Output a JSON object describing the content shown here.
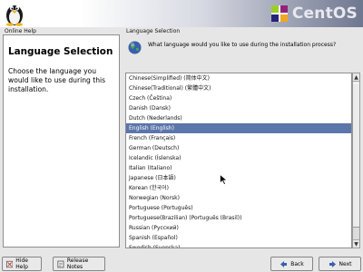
{
  "banner": {
    "brand_text": "CentOS"
  },
  "help": {
    "caption": "Online Help",
    "title": "Language Selection",
    "body": "Choose the language you would like to use during this installation."
  },
  "language": {
    "caption": "Language Selection",
    "question": "What language would you like to use during the installation process?",
    "items": [
      "Chinese(Simplified) (简体中文)",
      "Chinese(Traditional) (繁體中文)",
      "Czech (Čeština)",
      "Danish (Dansk)",
      "Dutch (Nederlands)",
      "English (English)",
      "French (Français)",
      "German (Deutsch)",
      "Icelandic (Íslenska)",
      "Italian (Italiano)",
      "Japanese (日本語)",
      "Korean (한국어)",
      "Norwegian (Norsk)",
      "Portuguese (Português)",
      "Portuguese(Brazilian) (Português (Brasil))",
      "Russian (Русский)",
      "Spanish (Español)",
      "Swedish (Svenska)"
    ],
    "selected_index": 5
  },
  "buttons": {
    "hide_help": "Hide Help",
    "release_notes": "Release Notes",
    "back": "Back",
    "next": "Next"
  },
  "colors": {
    "selection": "#5c75aa",
    "brand_text": "#e8e9ef"
  },
  "icons": {
    "banner_left": "tux-penguin-icon",
    "banner_right": "centos-logo-icon",
    "question": "globe-icon",
    "back": "left-arrow-icon",
    "next": "right-arrow-icon"
  }
}
